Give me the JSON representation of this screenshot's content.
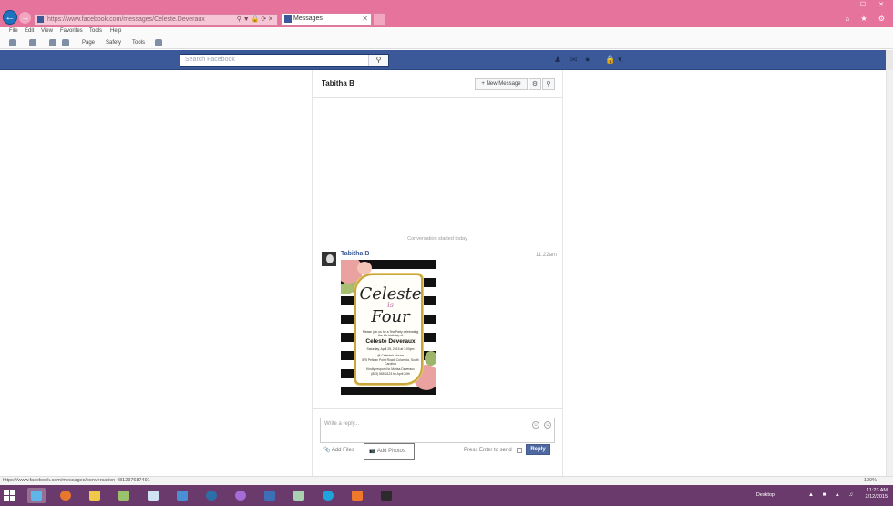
{
  "browser": {
    "url": "https://www.facebook.com/messages/Celeste.Deveraux",
    "tab_title": "Messages",
    "nav_back_icon": "back-arrow-icon",
    "menu": [
      "File",
      "Edit",
      "View",
      "Favorites",
      "Tools",
      "Help"
    ],
    "command_bar": [
      "Page",
      "Safety",
      "Tools"
    ],
    "status_url": "https://www.facebook.com/messages/conversation-481237687491",
    "zoom": "100%"
  },
  "facebook": {
    "search_placeholder": "Search Facebook",
    "accent": "#3b5998"
  },
  "conversation": {
    "title": "Tabitha B",
    "new_message_label": "+ New Message",
    "started_text": "Conversation started today",
    "messages": [
      {
        "sender": "Tabitha B",
        "time": "11:22am",
        "attachment": {
          "type": "image",
          "title_line1": "Celeste",
          "title_is": "is",
          "title_line2": "Four",
          "intro": "Please join us for a Tea Party celebrating the 4th birthday of",
          "name": "Celeste Deveraux",
          "date": "Saturday, April 25, 2015 at 3:00pm",
          "place": "@ Celeste's House",
          "address": "575 Pelican Point Road, Columbia, South Carolina",
          "rsvp": "Kindly respond to Marisa Deveraux",
          "phone": "(803) 555-0123 by April 20th"
        }
      }
    ]
  },
  "composer": {
    "placeholder": "Write a reply...",
    "add_files": "Add Files",
    "add_photos": "Add Photos",
    "press_enter": "Press Enter to send",
    "reply_button": "Reply"
  },
  "taskbar": {
    "desktop_label": "Desktop",
    "time": "11:23 AM",
    "date": "2/12/2015"
  }
}
